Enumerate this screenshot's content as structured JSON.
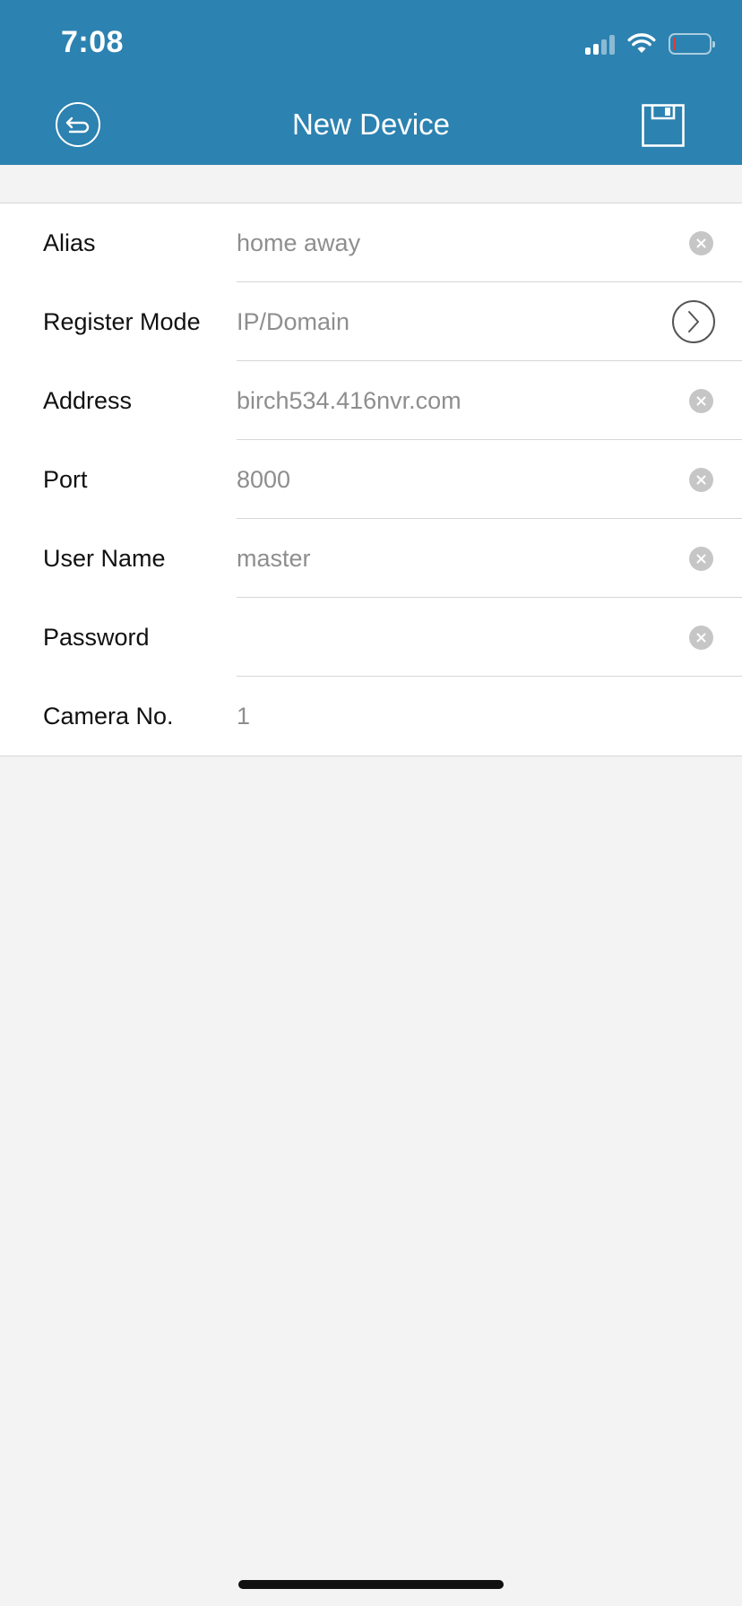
{
  "status_bar": {
    "time": "7:08",
    "battery_color": "#e53935"
  },
  "nav": {
    "title": "New Device",
    "back_icon": "back-arrow-icon",
    "save_icon": "floppy-disk-icon"
  },
  "form": {
    "alias": {
      "label": "Alias",
      "value": "home away",
      "icon": "clear-icon"
    },
    "register_mode": {
      "label": "Register Mode",
      "value": "IP/Domain",
      "icon": "chevron-right-icon"
    },
    "address": {
      "label": "Address",
      "value": "birch534.416nvr.com",
      "icon": "clear-icon"
    },
    "port": {
      "label": "Port",
      "value": "8000",
      "icon": "clear-icon"
    },
    "user_name": {
      "label": "User Name",
      "value": "master",
      "icon": "clear-icon"
    },
    "password": {
      "label": "Password",
      "value": "",
      "icon": "clear-icon"
    },
    "camera_no": {
      "label": "Camera No.",
      "value": "1"
    }
  },
  "colors": {
    "header_bg": "#2c82b0",
    "page_bg": "#f3f3f3",
    "value_text": "#8e8e8e"
  }
}
